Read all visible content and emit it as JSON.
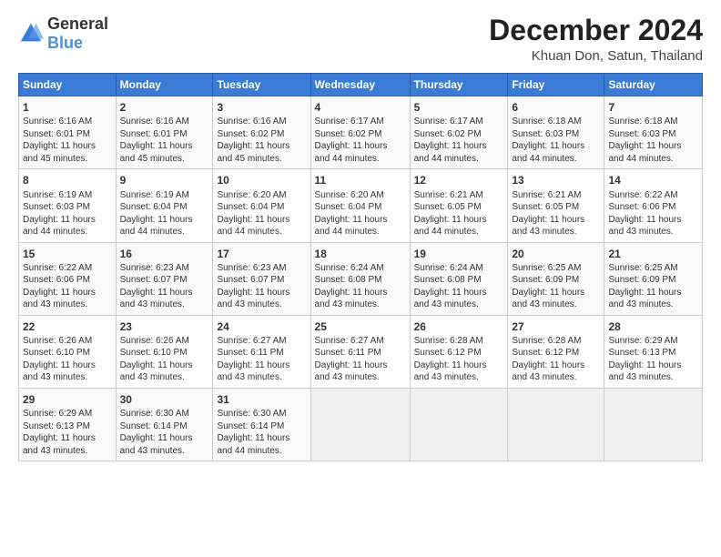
{
  "logo": {
    "general": "General",
    "blue": "Blue"
  },
  "header": {
    "month": "December 2024",
    "location": "Khuan Don, Satun, Thailand"
  },
  "weekdays": [
    "Sunday",
    "Monday",
    "Tuesday",
    "Wednesday",
    "Thursday",
    "Friday",
    "Saturday"
  ],
  "weeks": [
    [
      {
        "day": "1",
        "info": "Sunrise: 6:16 AM\nSunset: 6:01 PM\nDaylight: 11 hours\nand 45 minutes."
      },
      {
        "day": "2",
        "info": "Sunrise: 6:16 AM\nSunset: 6:01 PM\nDaylight: 11 hours\nand 45 minutes."
      },
      {
        "day": "3",
        "info": "Sunrise: 6:16 AM\nSunset: 6:02 PM\nDaylight: 11 hours\nand 45 minutes."
      },
      {
        "day": "4",
        "info": "Sunrise: 6:17 AM\nSunset: 6:02 PM\nDaylight: 11 hours\nand 44 minutes."
      },
      {
        "day": "5",
        "info": "Sunrise: 6:17 AM\nSunset: 6:02 PM\nDaylight: 11 hours\nand 44 minutes."
      },
      {
        "day": "6",
        "info": "Sunrise: 6:18 AM\nSunset: 6:03 PM\nDaylight: 11 hours\nand 44 minutes."
      },
      {
        "day": "7",
        "info": "Sunrise: 6:18 AM\nSunset: 6:03 PM\nDaylight: 11 hours\nand 44 minutes."
      }
    ],
    [
      {
        "day": "8",
        "info": "Sunrise: 6:19 AM\nSunset: 6:03 PM\nDaylight: 11 hours\nand 44 minutes."
      },
      {
        "day": "9",
        "info": "Sunrise: 6:19 AM\nSunset: 6:04 PM\nDaylight: 11 hours\nand 44 minutes."
      },
      {
        "day": "10",
        "info": "Sunrise: 6:20 AM\nSunset: 6:04 PM\nDaylight: 11 hours\nand 44 minutes."
      },
      {
        "day": "11",
        "info": "Sunrise: 6:20 AM\nSunset: 6:04 PM\nDaylight: 11 hours\nand 44 minutes."
      },
      {
        "day": "12",
        "info": "Sunrise: 6:21 AM\nSunset: 6:05 PM\nDaylight: 11 hours\nand 44 minutes."
      },
      {
        "day": "13",
        "info": "Sunrise: 6:21 AM\nSunset: 6:05 PM\nDaylight: 11 hours\nand 43 minutes."
      },
      {
        "day": "14",
        "info": "Sunrise: 6:22 AM\nSunset: 6:06 PM\nDaylight: 11 hours\nand 43 minutes."
      }
    ],
    [
      {
        "day": "15",
        "info": "Sunrise: 6:22 AM\nSunset: 6:06 PM\nDaylight: 11 hours\nand 43 minutes."
      },
      {
        "day": "16",
        "info": "Sunrise: 6:23 AM\nSunset: 6:07 PM\nDaylight: 11 hours\nand 43 minutes."
      },
      {
        "day": "17",
        "info": "Sunrise: 6:23 AM\nSunset: 6:07 PM\nDaylight: 11 hours\nand 43 minutes."
      },
      {
        "day": "18",
        "info": "Sunrise: 6:24 AM\nSunset: 6:08 PM\nDaylight: 11 hours\nand 43 minutes."
      },
      {
        "day": "19",
        "info": "Sunrise: 6:24 AM\nSunset: 6:08 PM\nDaylight: 11 hours\nand 43 minutes."
      },
      {
        "day": "20",
        "info": "Sunrise: 6:25 AM\nSunset: 6:09 PM\nDaylight: 11 hours\nand 43 minutes."
      },
      {
        "day": "21",
        "info": "Sunrise: 6:25 AM\nSunset: 6:09 PM\nDaylight: 11 hours\nand 43 minutes."
      }
    ],
    [
      {
        "day": "22",
        "info": "Sunrise: 6:26 AM\nSunset: 6:10 PM\nDaylight: 11 hours\nand 43 minutes."
      },
      {
        "day": "23",
        "info": "Sunrise: 6:26 AM\nSunset: 6:10 PM\nDaylight: 11 hours\nand 43 minutes."
      },
      {
        "day": "24",
        "info": "Sunrise: 6:27 AM\nSunset: 6:11 PM\nDaylight: 11 hours\nand 43 minutes."
      },
      {
        "day": "25",
        "info": "Sunrise: 6:27 AM\nSunset: 6:11 PM\nDaylight: 11 hours\nand 43 minutes."
      },
      {
        "day": "26",
        "info": "Sunrise: 6:28 AM\nSunset: 6:12 PM\nDaylight: 11 hours\nand 43 minutes."
      },
      {
        "day": "27",
        "info": "Sunrise: 6:28 AM\nSunset: 6:12 PM\nDaylight: 11 hours\nand 43 minutes."
      },
      {
        "day": "28",
        "info": "Sunrise: 6:29 AM\nSunset: 6:13 PM\nDaylight: 11 hours\nand 43 minutes."
      }
    ],
    [
      {
        "day": "29",
        "info": "Sunrise: 6:29 AM\nSunset: 6:13 PM\nDaylight: 11 hours\nand 43 minutes."
      },
      {
        "day": "30",
        "info": "Sunrise: 6:30 AM\nSunset: 6:14 PM\nDaylight: 11 hours\nand 43 minutes."
      },
      {
        "day": "31",
        "info": "Sunrise: 6:30 AM\nSunset: 6:14 PM\nDaylight: 11 hours\nand 44 minutes."
      },
      {
        "day": "",
        "info": ""
      },
      {
        "day": "",
        "info": ""
      },
      {
        "day": "",
        "info": ""
      },
      {
        "day": "",
        "info": ""
      }
    ]
  ]
}
